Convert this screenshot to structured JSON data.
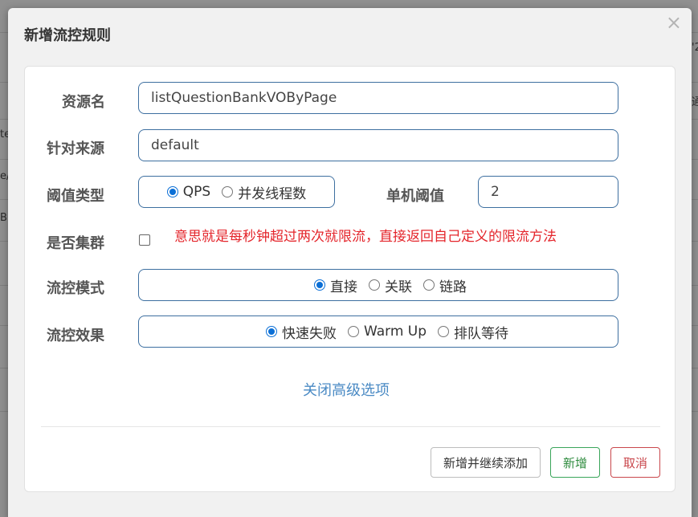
{
  "background": {
    "fragments": [
      "'2",
      "te",
      "e/",
      "B",
      "通"
    ]
  },
  "modal": {
    "title": "新增流控规则",
    "close_label": "×"
  },
  "form": {
    "resource_label": "资源名",
    "resource_value": "listQuestionBankVOByPage",
    "source_label": "针对来源",
    "source_value": "default",
    "threshold_type_label": "阈值类型",
    "threshold_type_options": [
      "QPS",
      "并发线程数"
    ],
    "threshold_type_selected": "QPS",
    "single_threshold_label": "单机阈值",
    "single_threshold_value": "2",
    "cluster_label": "是否集群",
    "cluster_checked": false,
    "annotation": "意思就是每秒钟超过两次就限流，直接返回自己定义的限流方法",
    "mode_label": "流控模式",
    "mode_options": [
      "直接",
      "关联",
      "链路"
    ],
    "mode_selected": "直接",
    "effect_label": "流控效果",
    "effect_options": [
      "快速失败",
      "Warm Up",
      "排队等待"
    ],
    "effect_selected": "快速失败",
    "advanced_toggle": "关闭高级选项"
  },
  "footer": {
    "add_continue_label": "新增并继续添加",
    "add_label": "新增",
    "cancel_label": "取消"
  },
  "colors": {
    "accent_border": "#3d6fa0",
    "radio_selected": "#0b6fd6",
    "annotation_red": "#e4252b",
    "link_blue": "#4a8ac4",
    "success_green": "#3aa55a",
    "danger_red": "#c9474c"
  }
}
